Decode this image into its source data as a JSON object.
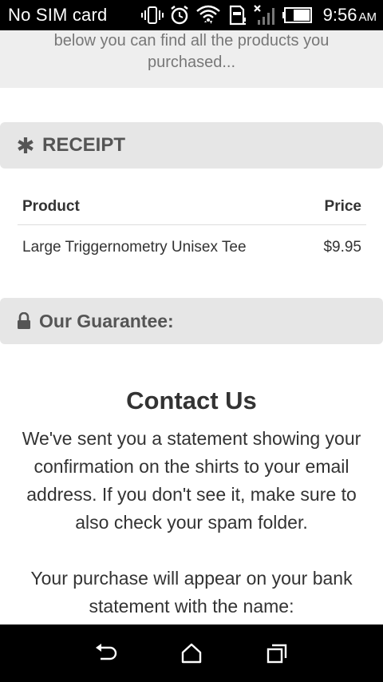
{
  "status_bar": {
    "carrier": "No SIM card",
    "time": "9:56",
    "ampm": "AM",
    "icons": [
      "vibrate-icon",
      "alarm-icon",
      "wifi-icon",
      "sd-card-icon",
      "no-signal-icon",
      "battery-icon"
    ]
  },
  "intro": {
    "text": "below you can find all the products you purchased..."
  },
  "receipt": {
    "title": "RECEIPT",
    "icon": "asterisk-icon",
    "columns": {
      "product": "Product",
      "price": "Price"
    },
    "rows": [
      {
        "product": "Large Triggernometry Unisex Tee",
        "price": "$9.95"
      }
    ]
  },
  "guarantee": {
    "title": "Our Guarantee:",
    "icon": "lock-icon"
  },
  "contact": {
    "title": "Contact Us",
    "body": "We've sent you a statement showing your confirmation on the shirts to your email address. If you don't see it, make sure to also check your spam folder.",
    "body2": "Your purchase will appear on your bank statement with the name:"
  },
  "nav_bar": {
    "icons": [
      "back-icon",
      "home-icon",
      "recent-apps-icon"
    ]
  }
}
